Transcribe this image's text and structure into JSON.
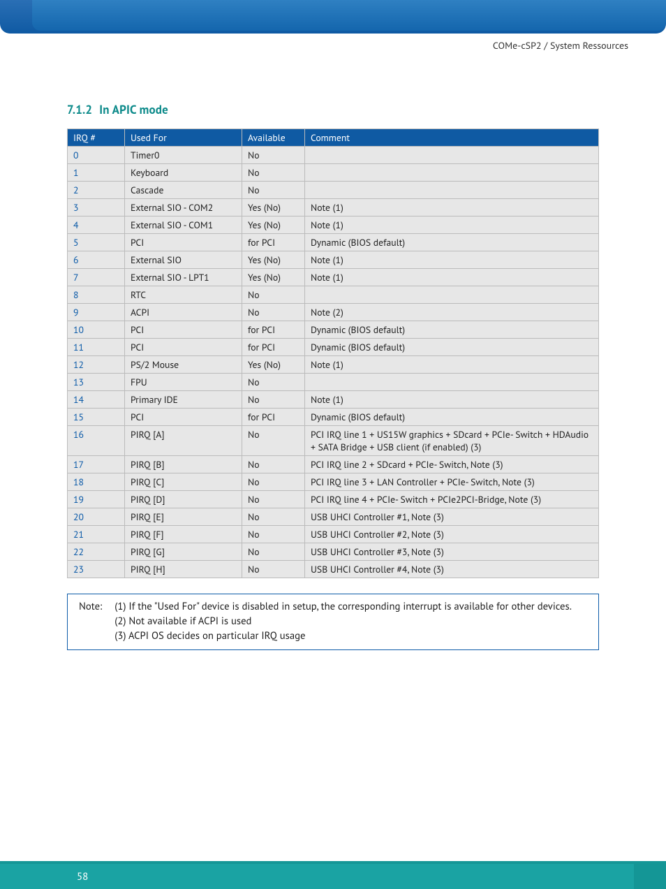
{
  "breadcrumb": "COMe-cSP2 / System Ressources",
  "section": {
    "number": "7.1.2",
    "title": "In APIC mode"
  },
  "columns": {
    "irq": "IRQ #",
    "used_for": "Used For",
    "available": "Available",
    "comment": "Comment"
  },
  "rows": [
    {
      "irq": "0",
      "used_for": "Timer0",
      "available": "No",
      "comment": ""
    },
    {
      "irq": "1",
      "used_for": "Keyboard",
      "available": "No",
      "comment": ""
    },
    {
      "irq": "2",
      "used_for": "Cascade",
      "available": "No",
      "comment": ""
    },
    {
      "irq": "3",
      "used_for": "External SIO - COM2",
      "available": "Yes (No)",
      "comment": "Note (1)"
    },
    {
      "irq": "4",
      "used_for": "External SIO - COM1",
      "available": "Yes (No)",
      "comment": "Note (1)"
    },
    {
      "irq": "5",
      "used_for": "PCI",
      "available": "for PCI",
      "comment": "Dynamic (BIOS default)"
    },
    {
      "irq": "6",
      "used_for": "External SIO",
      "available": "Yes (No)",
      "comment": "Note (1)"
    },
    {
      "irq": "7",
      "used_for": "External SIO - LPT1",
      "available": "Yes (No)",
      "comment": "Note (1)"
    },
    {
      "irq": "8",
      "used_for": "RTC",
      "available": "No",
      "comment": ""
    },
    {
      "irq": "9",
      "used_for": "ACPI",
      "available": "No",
      "comment": "Note (2)"
    },
    {
      "irq": "10",
      "used_for": "PCI",
      "available": "for PCI",
      "comment": "Dynamic (BIOS default)"
    },
    {
      "irq": "11",
      "used_for": "PCI",
      "available": "for PCI",
      "comment": "Dynamic (BIOS default)"
    },
    {
      "irq": "12",
      "used_for": "PS/2 Mouse",
      "available": "Yes (No)",
      "comment": "Note (1)"
    },
    {
      "irq": "13",
      "used_for": "FPU",
      "available": "No",
      "comment": ""
    },
    {
      "irq": "14",
      "used_for": "Primary IDE",
      "available": "No",
      "comment": "Note (1)"
    },
    {
      "irq": "15",
      "used_for": "PCI",
      "available": "for PCI",
      "comment": "Dynamic (BIOS default)"
    },
    {
      "irq": "16",
      "used_for": "PIRQ [A]",
      "available": "No",
      "comment": "PCI IRQ line 1 + US15W graphics + SDcard + PCIe- Switch + HDAudio + SATA Bridge + USB client (if enabled) (3)"
    },
    {
      "irq": "17",
      "used_for": "PIRQ [B]",
      "available": "No",
      "comment": "PCI IRQ line 2 + SDcard + PCIe- Switch, Note (3)"
    },
    {
      "irq": "18",
      "used_for": "PIRQ [C]",
      "available": "No",
      "comment": "PCI IRQ line 3 + LAN Controller + PCIe- Switch, Note (3)"
    },
    {
      "irq": "19",
      "used_for": "PIRQ [D]",
      "available": "No",
      "comment": "PCI IRQ line 4 + PCIe- Switch + PCIe2PCI-Bridge, Note (3)"
    },
    {
      "irq": "20",
      "used_for": "PIRQ [E]",
      "available": "No",
      "comment": "USB UHCI Controller #1, Note (3)"
    },
    {
      "irq": "21",
      "used_for": "PIRQ [F]",
      "available": "No",
      "comment": "USB UHCI Controller #2, Note (3)"
    },
    {
      "irq": "22",
      "used_for": "PIRQ [G]",
      "available": "No",
      "comment": "USB UHCI Controller #3, Note (3)"
    },
    {
      "irq": "23",
      "used_for": "PIRQ [H]",
      "available": "No",
      "comment": "USB UHCI Controller #4, Note (3)"
    }
  ],
  "note": {
    "label": "Note:",
    "lines": [
      "(1) If the \"Used For\" device is disabled in setup, the corresponding interrupt is available for other devices.",
      "(2) Not available if ACPI is used",
      "(3) ACPI OS decides on particular IRQ usage"
    ]
  },
  "page_number": "58"
}
